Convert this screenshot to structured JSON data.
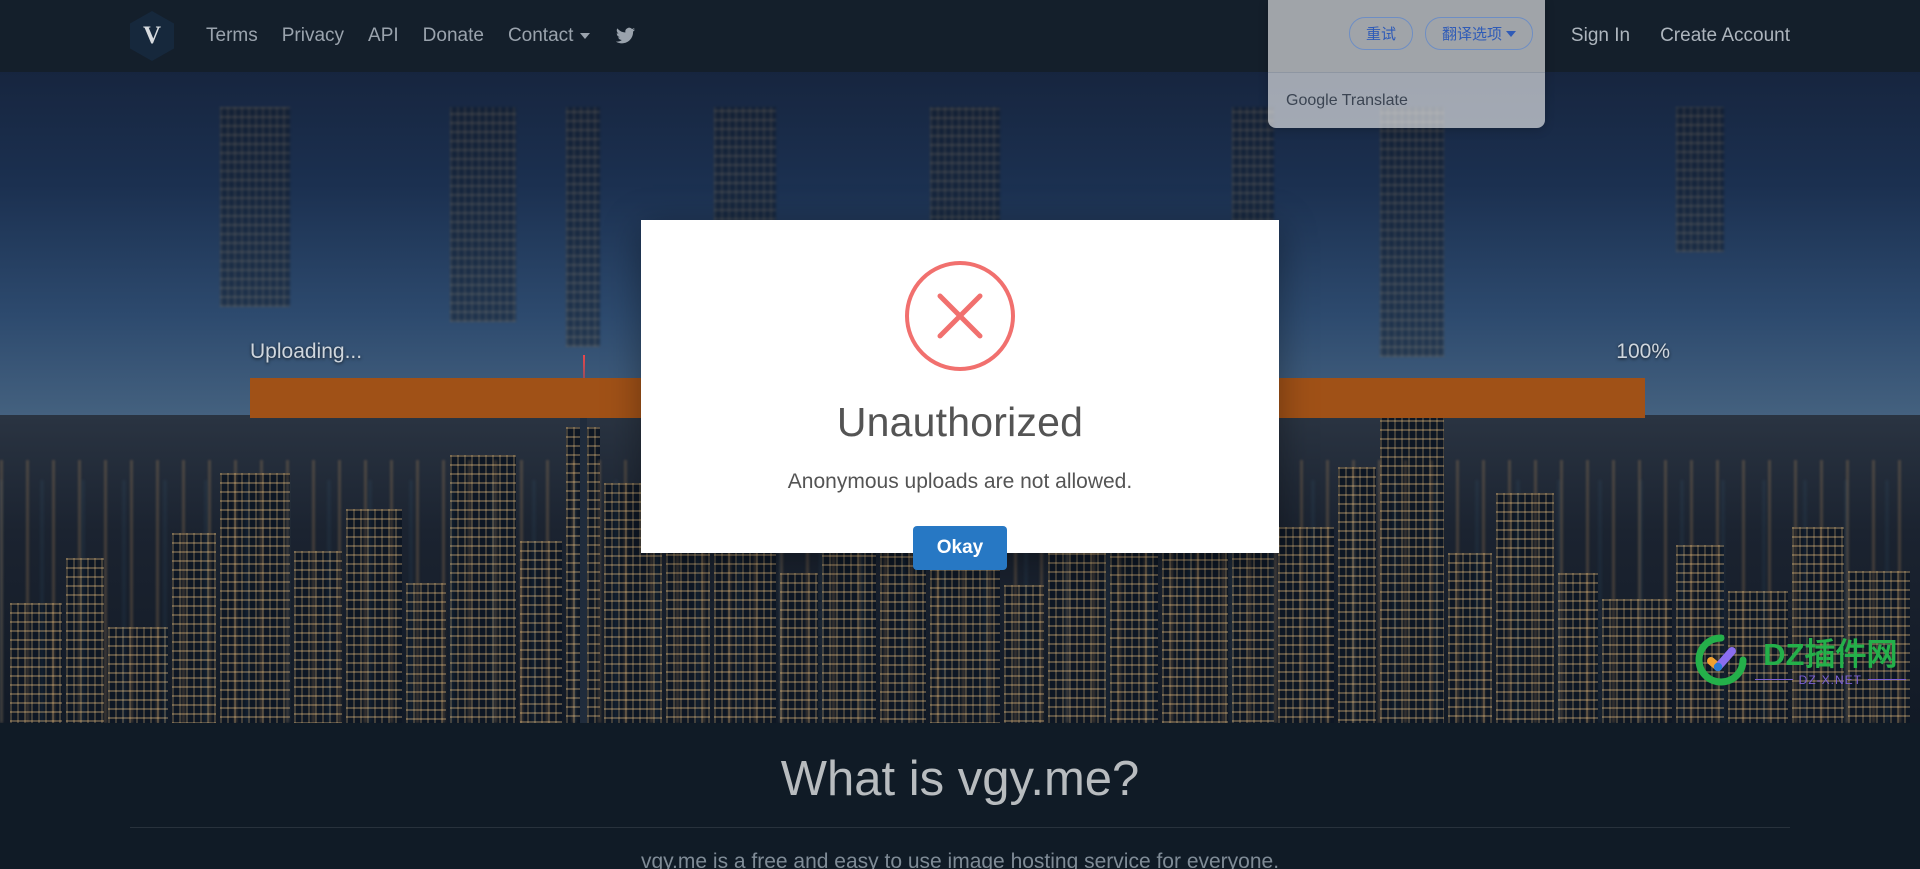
{
  "navbar": {
    "logo_letter": "V",
    "logo_name": "vgy-logo",
    "links": [
      {
        "label": "Terms",
        "name": "nav-link-terms"
      },
      {
        "label": "Privacy",
        "name": "nav-link-privacy"
      },
      {
        "label": "API",
        "name": "nav-link-api"
      },
      {
        "label": "Donate",
        "name": "nav-link-donate"
      },
      {
        "label": "Contact",
        "name": "nav-link-contact",
        "dropdown": true
      }
    ],
    "twitter_icon": "twitter-icon",
    "sign_in": "Sign In",
    "create_account": "Create Account"
  },
  "upload": {
    "status_label": "Uploading...",
    "percent_label": "100%",
    "progress_value": 100,
    "bar_color": "#a05117"
  },
  "modal": {
    "icon": "error-circle-x-icon",
    "icon_color": "#f1706e",
    "title": "Unauthorized",
    "message": "Anonymous uploads are not allowed.",
    "button_label": "Okay",
    "button_color": "#2778c4"
  },
  "translate_popup": {
    "retry_label": "重试",
    "options_label": "翻译选项",
    "brand": "Google Translate"
  },
  "section": {
    "title": "What is vgy.me?",
    "subtitle": "vgy.me is a free and easy to use image hosting service for everyone."
  },
  "watermark": {
    "main": "DZ插件网",
    "sub": "DZ-X.NET"
  }
}
